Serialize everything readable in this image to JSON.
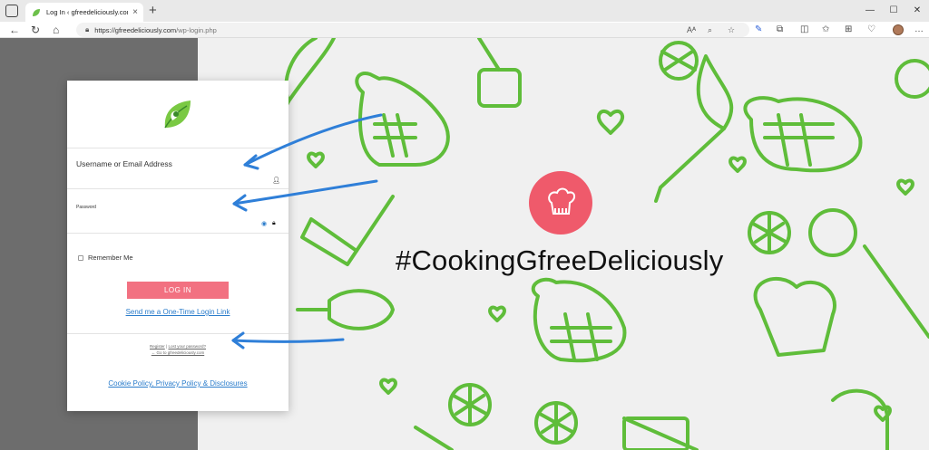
{
  "browser": {
    "tab_title": "Log In ‹ gfreedeliciously.com — …",
    "tab_close": "×",
    "new_tab": "+",
    "url_host": "https://gfreedeliciously.com",
    "url_path": "/wp-login.php"
  },
  "page": {
    "hashtag": "#CookingGfreeDeliciously",
    "background_color": "#f0f0f0",
    "doodle_color": "#5fbd3a",
    "badge_color": "#ef5a6b"
  },
  "login": {
    "username_label": "Username or Email Address",
    "password_label": "Password",
    "remember_label": "Remember Me",
    "login_button": "LOG IN",
    "one_time_link": "Send me a One-Time Login Link",
    "register_link": "Register",
    "separator": "|",
    "lost_password_link": "Lost your password?",
    "back_link": "← Go to gfreedeliciously.com",
    "policy_link": "Cookie Policy, Privacy Policy & Disclosures",
    "button_color": "#f27181",
    "link_color": "#2a7ccb"
  },
  "annotations": {
    "arrow_color": "#2f7fd8"
  }
}
